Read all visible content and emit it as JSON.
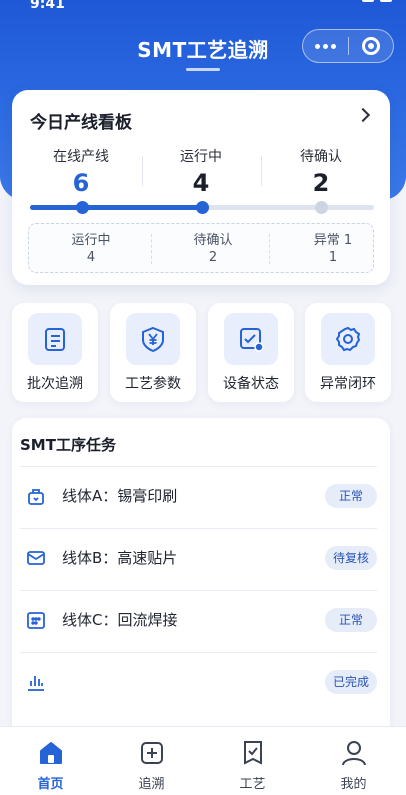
{
  "status_bar": {
    "time": "9:41"
  },
  "nav": {
    "title": "SMT工艺追溯"
  },
  "dashboard": {
    "title": "今日产线看板",
    "stats": [
      {
        "label": "在线产线",
        "value": "6"
      },
      {
        "label": "运行中",
        "value": "4"
      },
      {
        "label": "待确认",
        "value": "2"
      }
    ],
    "progress": {
      "filled_fraction": 0.5,
      "steps_reached": 2,
      "steps_total": 3
    },
    "sub_stats": [
      {
        "label": "运行中",
        "value": "4"
      },
      {
        "label": "待确认",
        "value": "2"
      },
      {
        "label": "异常 1",
        "value": "1"
      }
    ]
  },
  "shortcuts": [
    {
      "label": "批次追溯",
      "icon": "clipboard-icon"
    },
    {
      "label": "工艺参数",
      "icon": "yen-shield-icon"
    },
    {
      "label": "设备状态",
      "icon": "device-check-icon"
    },
    {
      "label": "异常闭环",
      "icon": "gear-icon"
    }
  ],
  "tasks": {
    "title": "SMT工序任务",
    "items": [
      {
        "name": "线体A：锡膏印刷",
        "status": "正常",
        "icon": "bag-icon"
      },
      {
        "name": "线体B：高速贴片",
        "status": "待复核",
        "icon": "envelope-icon"
      },
      {
        "name": "线体C：回流焊接",
        "status": "正常",
        "icon": "calendar-icon"
      },
      {
        "name": "",
        "status": "已完成",
        "icon": "bar-chart-icon"
      }
    ]
  },
  "tabbar": [
    {
      "label": "首页",
      "icon": "home-icon",
      "active": true
    },
    {
      "label": "追溯",
      "icon": "plus-square-icon",
      "active": false
    },
    {
      "label": "工艺",
      "icon": "shield-check-icon",
      "active": false
    },
    {
      "label": "我的",
      "icon": "user-icon",
      "active": false
    }
  ],
  "colors": {
    "primary": "#2563d6",
    "badge_bg": "#e6ecf8"
  }
}
